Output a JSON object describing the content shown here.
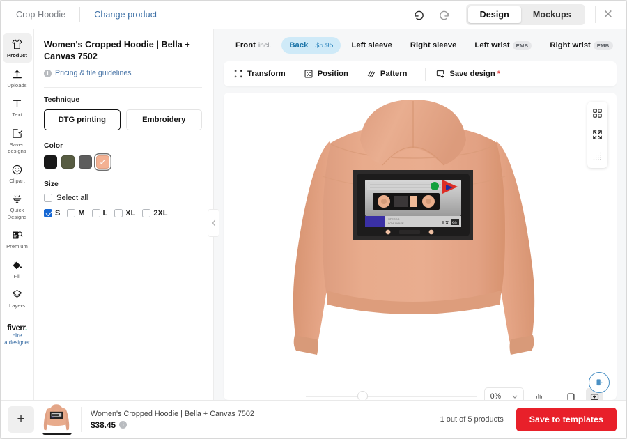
{
  "topbar": {
    "breadcrumb_product": "Crop Hoodie",
    "change_product": "Change product",
    "undo_icon": "undo-arrow-icon",
    "redo_icon": "redo-arrow-icon",
    "view_design": "Design",
    "view_mockups": "Mockups",
    "close_icon": "close-icon",
    "active_view": "Design"
  },
  "rail": {
    "items": [
      {
        "label": "Product",
        "icon": "tshirt-icon",
        "active": true
      },
      {
        "label": "Uploads",
        "icon": "upload-icon",
        "active": false
      },
      {
        "label": "Text",
        "icon": "text-t-icon",
        "active": false
      },
      {
        "label": "Saved\ndesigns",
        "icon": "saved-designs-icon",
        "active": false
      },
      {
        "label": "Clipart",
        "icon": "smiley-icon",
        "active": false
      },
      {
        "label": "Quick\nDesigns",
        "icon": "quick-designs-icon",
        "active": false
      },
      {
        "label": "Premium",
        "icon": "premium-icon",
        "active": false
      },
      {
        "label": "Fill",
        "icon": "paint-bucket-icon",
        "active": false
      },
      {
        "label": "Layers",
        "icon": "layers-icon",
        "active": false
      }
    ],
    "fiverr_logo": "fiverr",
    "fiverr_hire": "Hire\na designer"
  },
  "panel": {
    "title": "Women's Cropped Hoodie | Bella + Canvas 7502",
    "pricing_link": "Pricing & file guidelines",
    "info_icon": "info-icon",
    "technique_label": "Technique",
    "technique_options": [
      {
        "label": "DTG printing",
        "selected": true
      },
      {
        "label": "Embroidery",
        "selected": false
      }
    ],
    "color_label": "Color",
    "colors": [
      {
        "name": "black",
        "hex": "#191919",
        "selected": false
      },
      {
        "name": "military-green",
        "hex": "#575c42",
        "selected": false
      },
      {
        "name": "storm",
        "hex": "#5d5d5d",
        "selected": false
      },
      {
        "name": "peach",
        "hex": "#f3b193",
        "selected": true
      }
    ],
    "size_label": "Size",
    "select_all_label": "Select all",
    "select_all_checked": false,
    "sizes": [
      {
        "label": "S",
        "checked": true
      },
      {
        "label": "M",
        "checked": false
      },
      {
        "label": "L",
        "checked": false
      },
      {
        "label": "XL",
        "checked": false
      },
      {
        "label": "2XL",
        "checked": false
      }
    ],
    "collapse_icon": "chevron-left-icon"
  },
  "placement_tabs": [
    {
      "label": "Front",
      "sub": "incl.",
      "badge": "",
      "active": false
    },
    {
      "label": "Back",
      "sub": "+$5.95",
      "badge": "",
      "active": true
    },
    {
      "label": "Left sleeve",
      "sub": "",
      "badge": "",
      "active": false
    },
    {
      "label": "Right sleeve",
      "sub": "",
      "badge": "",
      "active": false
    },
    {
      "label": "Left wrist",
      "sub": "",
      "badge": "EMB",
      "active": false
    },
    {
      "label": "Right wrist",
      "sub": "",
      "badge": "EMB",
      "active": false
    }
  ],
  "toolbar": {
    "transform": "Transform",
    "transform_icon": "transform-icon",
    "position": "Position",
    "position_icon": "position-icon",
    "pattern": "Pattern",
    "pattern_icon": "pattern-icon",
    "save_design": "Save design",
    "save_design_icon": "save-design-icon",
    "required_marker": "*"
  },
  "canvas": {
    "float_tools": [
      {
        "icon": "grid-layout-icon"
      },
      {
        "icon": "fullscreen-expand-icon"
      },
      {
        "icon": "dotted-grid-icon"
      }
    ],
    "garment_color": "#e6a384",
    "garment_shadow": "#d4916f",
    "design_name": "cassette-tape-design",
    "chat_icon": "chat-support-icon",
    "zoom_value": "0%",
    "chevron_icon": "chevron-down-icon",
    "bars_icon": "bars-icon",
    "view_flat_icon": "flat-view-icon",
    "view_card_icon": "card-view-icon"
  },
  "footer": {
    "add_label": "+",
    "product_name": "Women's Cropped Hoodie | Bella + Canvas 7502",
    "price": "$38.45",
    "price_info_icon": "info-icon",
    "count_text": "1 out of 5 products",
    "save_button": "Save to templates"
  }
}
